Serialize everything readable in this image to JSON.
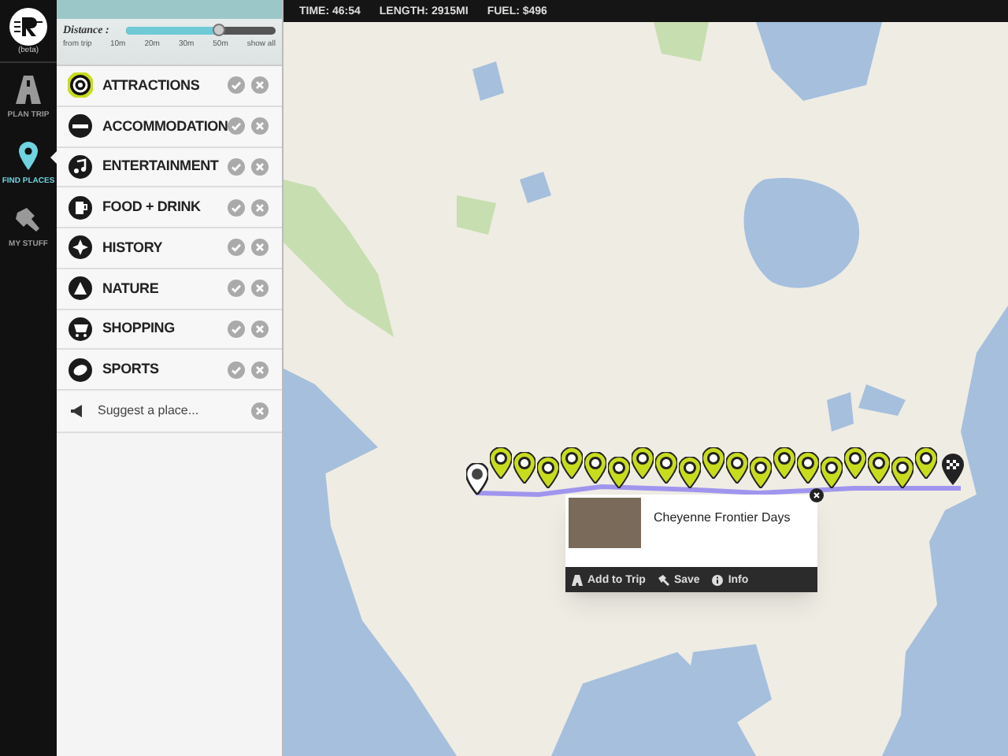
{
  "logo": {
    "badge": "(beta)"
  },
  "nav": [
    {
      "label": "PLAN TRIP",
      "kind": "road",
      "selected": false
    },
    {
      "label": "FIND PLACES",
      "kind": "pin",
      "selected": true
    },
    {
      "label": "MY STUFF",
      "kind": "pushpin",
      "selected": false
    }
  ],
  "distance": {
    "label": "Distance :",
    "sublabel": "from trip",
    "level": 0.62,
    "ticks": [
      "10m",
      "20m",
      "30m",
      "50m",
      "show all"
    ]
  },
  "categories": [
    {
      "label": "ATTRACTIONS",
      "kind": "attractions",
      "selected": true
    },
    {
      "label": "ACCOMMODATION",
      "kind": "bed",
      "selected": false
    },
    {
      "label": "ENTERTAINMENT",
      "kind": "music",
      "selected": false
    },
    {
      "label": "FOOD + DRINK",
      "kind": "food",
      "selected": false
    },
    {
      "label": "HISTORY",
      "kind": "history",
      "selected": false
    },
    {
      "label": "NATURE",
      "kind": "nature",
      "selected": false
    },
    {
      "label": "SHOPPING",
      "kind": "shopping",
      "selected": false
    },
    {
      "label": "SPORTS",
      "kind": "sports",
      "selected": false
    }
  ],
  "suggest": {
    "label": "Suggest a place..."
  },
  "status_bar": [
    "TIME: 46:54",
    "LENGTH: 2915MI",
    "FUEL: $496"
  ],
  "popup": {
    "title": "Cheyenne Frontier Days",
    "actions": [
      {
        "label": "Add to Trip",
        "kind": "add"
      },
      {
        "label": "Save",
        "kind": "save"
      },
      {
        "label": "Info",
        "kind": "info"
      }
    ]
  }
}
